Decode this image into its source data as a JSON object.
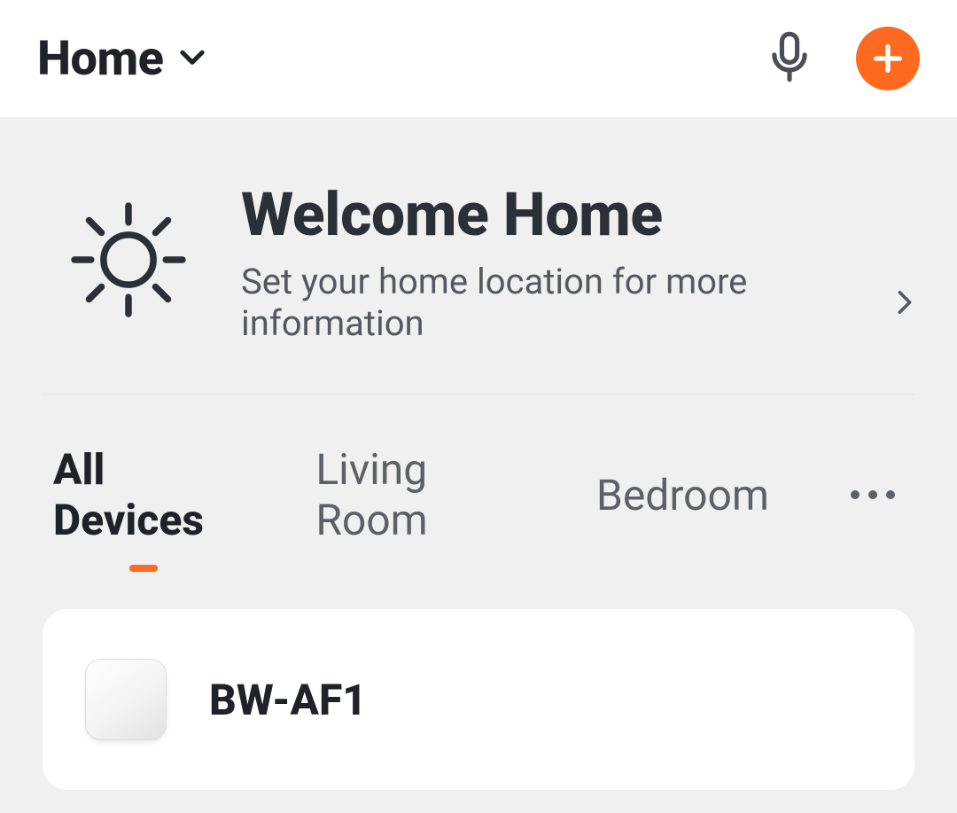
{
  "header": {
    "title": "Home"
  },
  "welcome": {
    "title": "Welcome Home",
    "subtitle": "Set your home location for more information"
  },
  "tabs": [
    {
      "label": "All Devices",
      "active": true
    },
    {
      "label": "Living Room",
      "active": false
    },
    {
      "label": "Bedroom",
      "active": false
    }
  ],
  "devices": [
    {
      "name": "BW-AF1"
    }
  ],
  "colors": {
    "accent": "#ff6a20"
  }
}
